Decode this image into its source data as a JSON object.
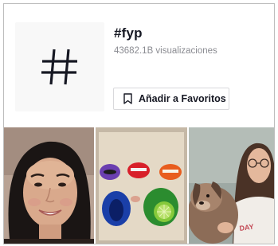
{
  "hashtag": {
    "title": "#fyp",
    "views": "43682.1B visualizaciones",
    "icon": "hashtag-icon"
  },
  "favorite_button": {
    "label": "Añadir a Favoritos",
    "icon": "bookmark-icon"
  },
  "videos": [
    {
      "name": "video-thumbnail-girl-smiling"
    },
    {
      "name": "video-thumbnail-lips-art"
    },
    {
      "name": "video-thumbnail-woman-with-dog"
    }
  ],
  "colors": {
    "title": "#161823",
    "secondary_text": "#8a8b91",
    "border": "#d9d9dc"
  }
}
